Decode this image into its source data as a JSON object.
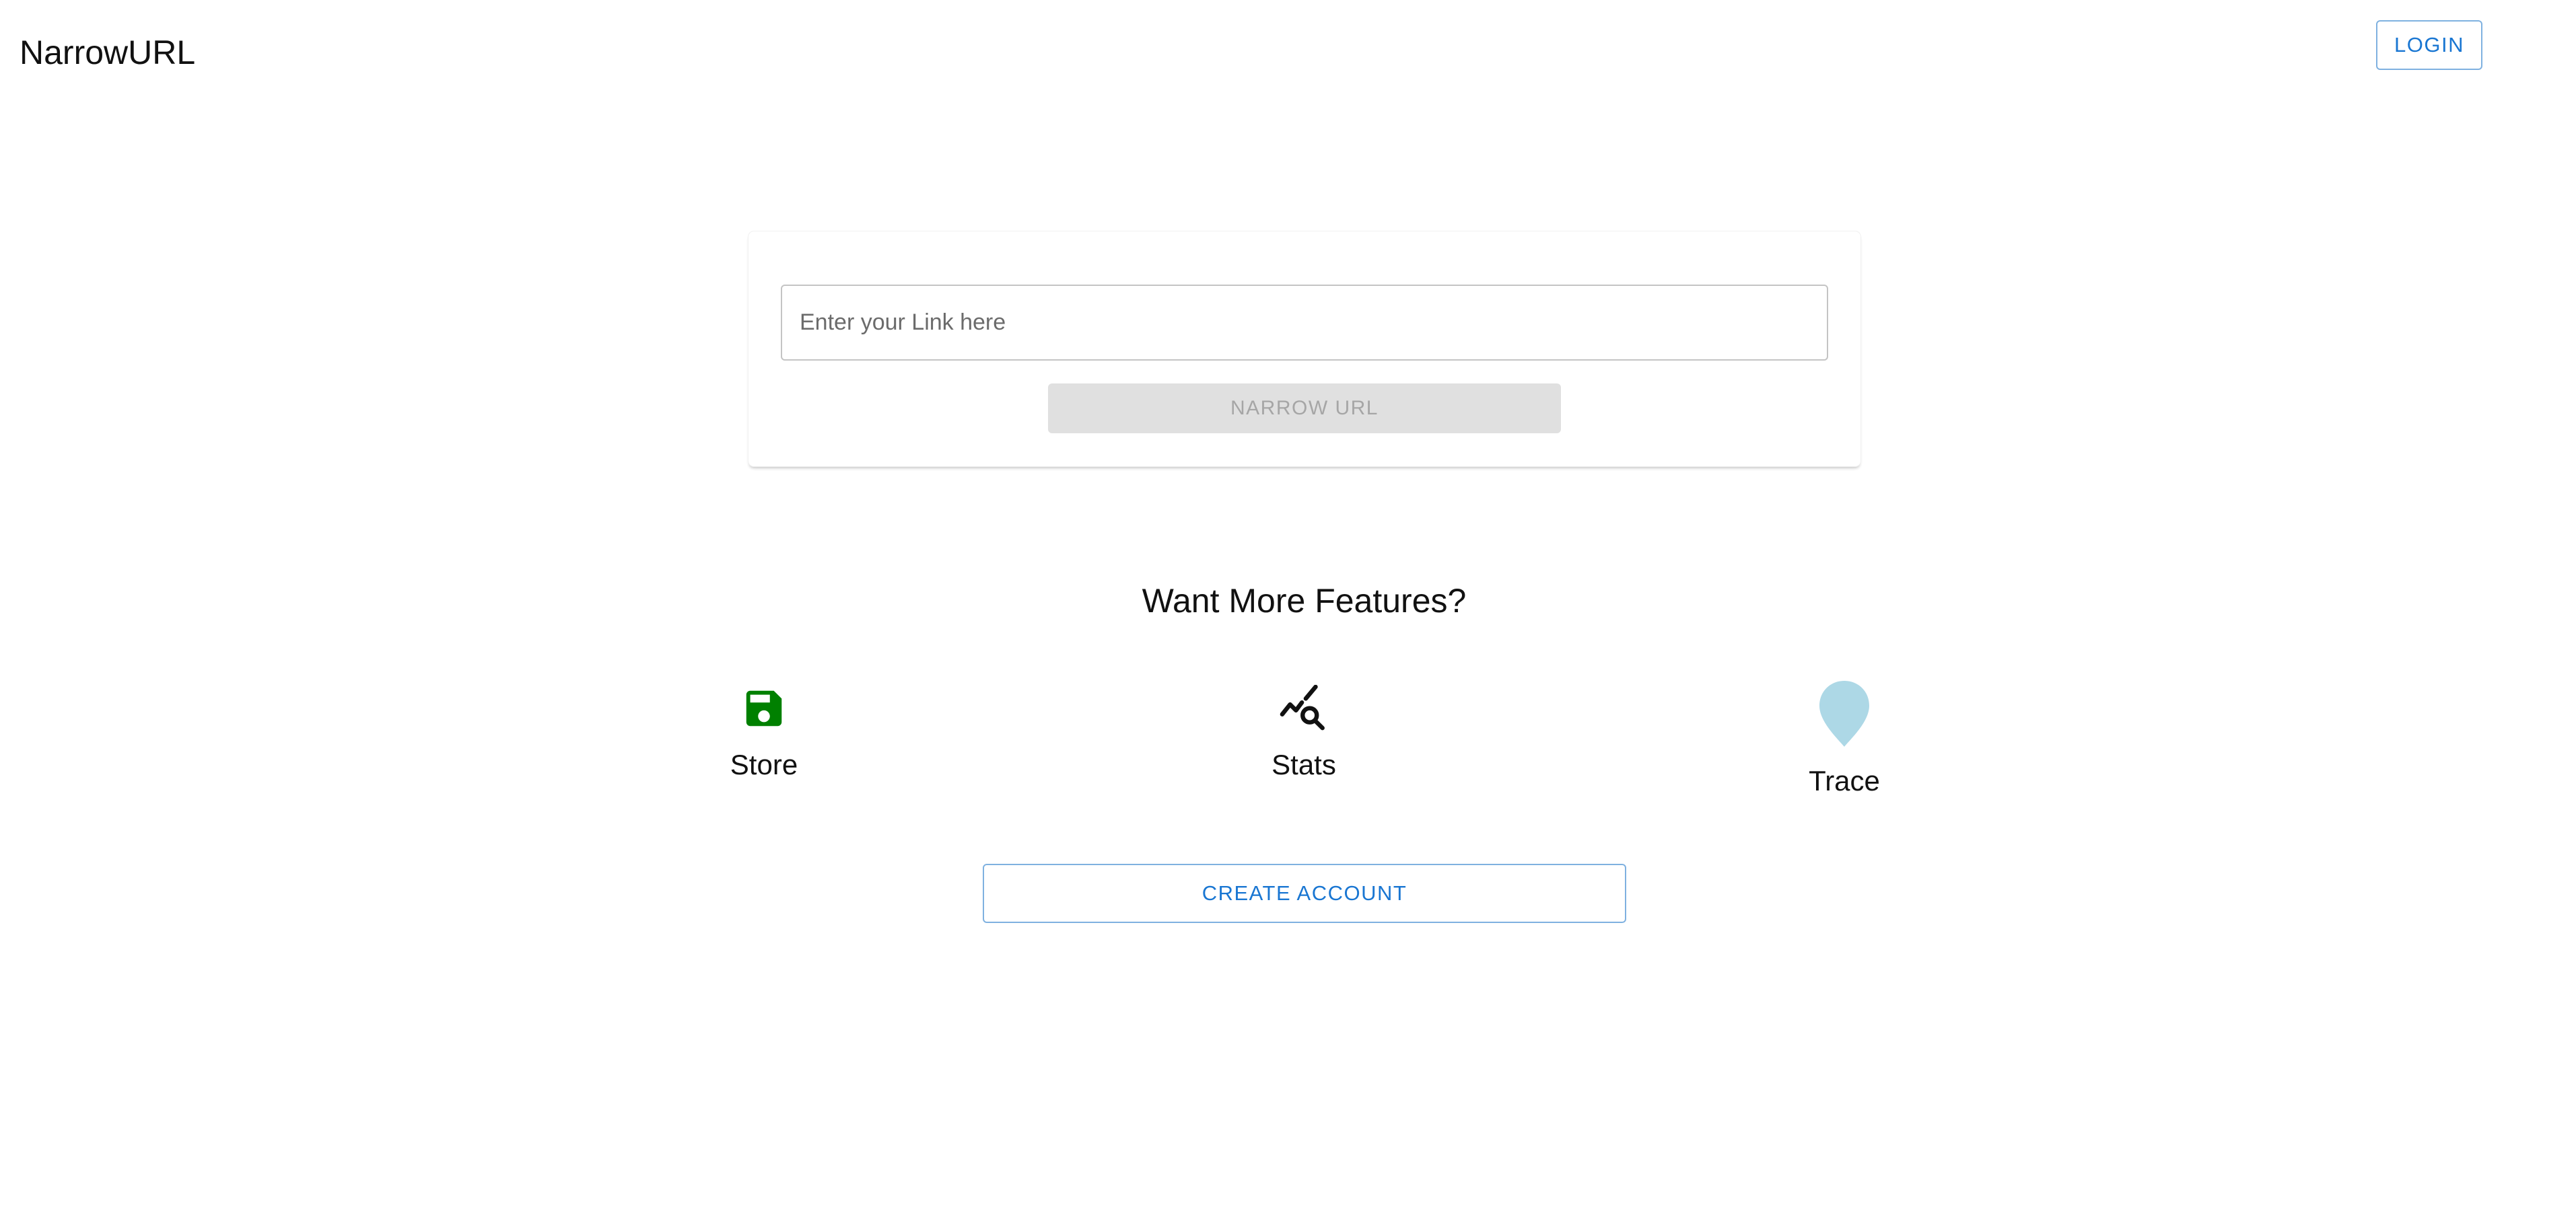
{
  "header": {
    "brand": "NarrowURL",
    "login_label": "LOGIN"
  },
  "shortener": {
    "input_value": "",
    "input_placeholder": "Enter your Link here",
    "submit_label": "NARROW URL"
  },
  "features": {
    "heading": "Want More Features?",
    "items": [
      {
        "label": "Store",
        "icon": "floppy-disk-icon",
        "color": "#008000"
      },
      {
        "label": "Stats",
        "icon": "query-stats-icon",
        "color": "#111111"
      },
      {
        "label": "Trace",
        "icon": "map-pin-icon",
        "color": "#add8e6"
      }
    ],
    "create_account_label": "CREATE ACCOUNT"
  },
  "colors": {
    "primary": "#1976d2",
    "outline": "#7fb1e0",
    "disabled_bg": "#e0e0e0",
    "disabled_text": "#a6a6a6"
  }
}
